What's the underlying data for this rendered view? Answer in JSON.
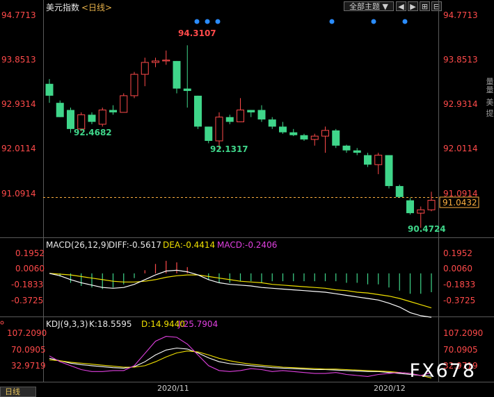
{
  "header": {
    "title": "美元指数",
    "period": "<日线>",
    "theme_dropdown": "全部主题",
    "dropdown_arrow": "▼",
    "nav_icons": [
      "prev-icon",
      "next-icon",
      "pin-icon",
      "collapse-icon"
    ]
  },
  "side_tabs": [
    "量",
    "量",
    "美",
    "提"
  ],
  "bottom_tab": {
    "label": "日线"
  },
  "watermark": "FX678",
  "x_axis": {
    "labels": [
      "2020/11",
      "2020/12"
    ]
  },
  "price_panel": {
    "axis_labels": [
      "94.7713",
      "93.8513",
      "92.9314",
      "92.0114",
      "91.0914"
    ],
    "current_price": "91.0432",
    "annotations": {
      "high": "94.3107",
      "low1": "92.4682",
      "low2": "92.1317",
      "low3": "90.4724"
    }
  },
  "macd_panel": {
    "label": "MACD(26,12,9)",
    "diff": "DIFF:-0.5617",
    "dea": "DEA:-0.4414",
    "macd": "MACD:-0.2406",
    "axis_labels": [
      "0.1952",
      "0.0060",
      "-0.1833",
      "-0.3725"
    ]
  },
  "kdj_panel": {
    "label": "KDJ(9,3,3)",
    "k": "K:18.5595",
    "d": "D:14.9440",
    "j": "J:25.7904",
    "axis_labels": [
      "107.2090",
      "70.0905",
      "32.9719"
    ]
  },
  "colors": {
    "up": "#ff4a4a",
    "down": "#3fd68a",
    "axis_text": "#e0e0e0",
    "macd_diff": "#ffffff",
    "macd_dea": "#f0e000",
    "macd_label": "#e040e0",
    "current_price": "#ffb040",
    "grid": "#3a3a3a"
  },
  "chart_data": [
    {
      "type": "candlestick",
      "title": "美元指数",
      "ylim": [
        90.3,
        95.0
      ],
      "candles": [
        {
          "o": 93.5,
          "h": 93.6,
          "l": 93.1,
          "c": 93.25
        },
        {
          "o": 93.1,
          "h": 93.15,
          "l": 92.8,
          "c": 92.8
        },
        {
          "o": 92.95,
          "h": 93.0,
          "l": 92.47,
          "c": 92.55
        },
        {
          "o": 92.55,
          "h": 92.9,
          "l": 92.5,
          "c": 92.85
        },
        {
          "o": 92.85,
          "h": 92.9,
          "l": 92.65,
          "c": 92.7
        },
        {
          "o": 92.65,
          "h": 93.0,
          "l": 92.6,
          "c": 92.95
        },
        {
          "o": 92.95,
          "h": 93.05,
          "l": 92.85,
          "c": 92.9
        },
        {
          "o": 92.9,
          "h": 93.3,
          "l": 92.9,
          "c": 93.25
        },
        {
          "o": 93.25,
          "h": 93.75,
          "l": 93.2,
          "c": 93.7
        },
        {
          "o": 93.7,
          "h": 94.05,
          "l": 93.45,
          "c": 93.95
        },
        {
          "o": 93.95,
          "h": 94.05,
          "l": 93.85,
          "c": 93.98
        },
        {
          "o": 93.98,
          "h": 94.2,
          "l": 93.9,
          "c": 94.0
        },
        {
          "o": 93.98,
          "h": 93.98,
          "l": 93.3,
          "c": 93.4
        },
        {
          "o": 93.4,
          "h": 94.31,
          "l": 93.0,
          "c": 93.35
        },
        {
          "o": 93.25,
          "h": 93.25,
          "l": 92.55,
          "c": 92.6
        },
        {
          "o": 92.6,
          "h": 92.6,
          "l": 92.25,
          "c": 92.3
        },
        {
          "o": 92.3,
          "h": 92.9,
          "l": 92.13,
          "c": 92.8
        },
        {
          "o": 92.8,
          "h": 92.85,
          "l": 92.65,
          "c": 92.7
        },
        {
          "o": 92.7,
          "h": 93.2,
          "l": 92.7,
          "c": 92.95
        },
        {
          "o": 92.95,
          "h": 92.95,
          "l": 92.8,
          "c": 92.9
        },
        {
          "o": 92.95,
          "h": 93.05,
          "l": 92.7,
          "c": 92.75
        },
        {
          "o": 92.75,
          "h": 92.8,
          "l": 92.55,
          "c": 92.6
        },
        {
          "o": 92.6,
          "h": 92.7,
          "l": 92.45,
          "c": 92.48
        },
        {
          "o": 92.48,
          "h": 92.55,
          "l": 92.4,
          "c": 92.42
        },
        {
          "o": 92.42,
          "h": 92.45,
          "l": 92.3,
          "c": 92.33
        },
        {
          "o": 92.33,
          "h": 92.45,
          "l": 92.2,
          "c": 92.4
        },
        {
          "o": 92.4,
          "h": 92.6,
          "l": 92.05,
          "c": 92.52
        },
        {
          "o": 92.52,
          "h": 92.55,
          "l": 92.15,
          "c": 92.2
        },
        {
          "o": 92.2,
          "h": 92.22,
          "l": 92.05,
          "c": 92.1
        },
        {
          "o": 92.1,
          "h": 92.15,
          "l": 92.0,
          "c": 92.05
        },
        {
          "o": 92.0,
          "h": 92.05,
          "l": 91.75,
          "c": 91.8
        },
        {
          "o": 91.8,
          "h": 92.05,
          "l": 91.6,
          "c": 92.0
        },
        {
          "o": 92.0,
          "h": 92.0,
          "l": 91.3,
          "c": 91.35
        },
        {
          "o": 91.35,
          "h": 91.38,
          "l": 91.1,
          "c": 91.12
        },
        {
          "o": 91.05,
          "h": 91.1,
          "l": 90.75,
          "c": 90.78
        },
        {
          "o": 90.78,
          "h": 90.92,
          "l": 90.47,
          "c": 90.85
        },
        {
          "o": 90.85,
          "h": 91.23,
          "l": 90.82,
          "c": 91.05
        }
      ]
    },
    {
      "type": "bar+line",
      "title": "MACD(26,12,9)",
      "ylim": [
        -0.55,
        0.3
      ],
      "series": [
        {
          "name": "DIFF",
          "values": [
            0.0,
            -0.03,
            -0.08,
            -0.12,
            -0.15,
            -0.18,
            -0.19,
            -0.18,
            -0.14,
            -0.08,
            -0.02,
            0.03,
            0.04,
            0.02,
            -0.02,
            -0.08,
            -0.12,
            -0.14,
            -0.15,
            -0.16,
            -0.18,
            -0.19,
            -0.2,
            -0.21,
            -0.22,
            -0.23,
            -0.24,
            -0.26,
            -0.28,
            -0.3,
            -0.32,
            -0.34,
            -0.38,
            -0.43,
            -0.5,
            -0.54,
            -0.56
          ]
        },
        {
          "name": "DEA",
          "values": [
            0.0,
            -0.01,
            -0.02,
            -0.04,
            -0.06,
            -0.08,
            -0.1,
            -0.11,
            -0.11,
            -0.1,
            -0.08,
            -0.05,
            -0.03,
            -0.02,
            -0.02,
            -0.04,
            -0.06,
            -0.08,
            -0.1,
            -0.11,
            -0.12,
            -0.14,
            -0.15,
            -0.16,
            -0.17,
            -0.18,
            -0.19,
            -0.21,
            -0.22,
            -0.24,
            -0.25,
            -0.27,
            -0.29,
            -0.32,
            -0.36,
            -0.4,
            -0.44
          ]
        },
        {
          "name": "MACD",
          "values": [
            0.0,
            -0.04,
            -0.12,
            -0.16,
            -0.18,
            -0.2,
            -0.18,
            -0.14,
            -0.06,
            0.04,
            0.12,
            0.16,
            0.14,
            0.08,
            0.0,
            -0.08,
            -0.12,
            -0.12,
            -0.1,
            -0.1,
            -0.12,
            -0.1,
            -0.1,
            -0.1,
            -0.1,
            -0.1,
            -0.1,
            -0.1,
            -0.12,
            -0.12,
            -0.14,
            -0.14,
            -0.18,
            -0.22,
            -0.26,
            -0.26,
            -0.24
          ]
        }
      ]
    },
    {
      "type": "line",
      "title": "KDJ(9,3,3)",
      "ylim": [
        10,
        115
      ],
      "series": [
        {
          "name": "K",
          "values": [
            55,
            50,
            45,
            42,
            40,
            38,
            36,
            35,
            38,
            48,
            62,
            72,
            76,
            74,
            66,
            56,
            48,
            44,
            42,
            40,
            38,
            36,
            35,
            34,
            33,
            32,
            32,
            31,
            30,
            29,
            28,
            28,
            26,
            24,
            22,
            20,
            18.56
          ]
        },
        {
          "name": "D",
          "values": [
            52,
            50,
            47,
            45,
            43,
            41,
            39,
            37,
            37,
            40,
            48,
            58,
            66,
            70,
            68,
            62,
            55,
            50,
            46,
            43,
            41,
            39,
            37,
            36,
            35,
            34,
            33,
            33,
            32,
            31,
            30,
            29,
            28,
            26,
            24,
            20,
            14.94
          ]
        },
        {
          "name": "J",
          "values": [
            60,
            48,
            40,
            32,
            28,
            28,
            30,
            30,
            40,
            65,
            90,
            100,
            98,
            84,
            62,
            40,
            30,
            28,
            30,
            34,
            32,
            28,
            30,
            28,
            26,
            24,
            24,
            26,
            22,
            20,
            18,
            22,
            24,
            26,
            24,
            20,
            25.79
          ]
        }
      ]
    }
  ]
}
